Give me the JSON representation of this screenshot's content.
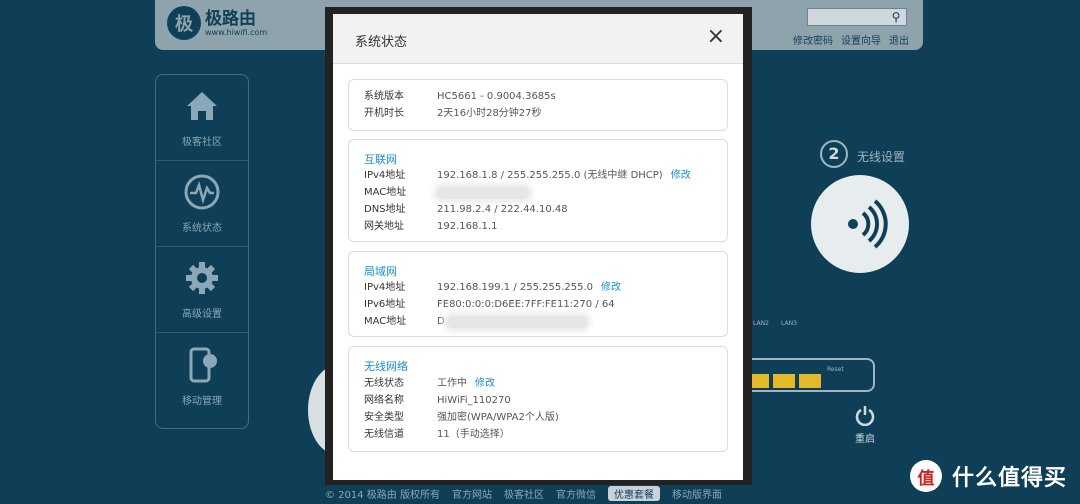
{
  "bg": {
    "logo_mark": "极",
    "logo_name": "极路由",
    "logo_url": "www.hiwifi.com",
    "top_links": [
      "修改密码",
      "设置向导",
      "退出"
    ],
    "sidebar": [
      "极客社区",
      "系统状态",
      "高级设置",
      "移动管理"
    ],
    "step_number": "2",
    "step_label": "无线设置",
    "port_labels": [
      "LAN2",
      "LAN3",
      "Reset"
    ],
    "restart_label": "重启",
    "footer": [
      "© 2014 极路由 版权所有",
      "官方网站",
      "极客社区",
      "官方微信",
      "优惠套餐",
      "移动版界面"
    ]
  },
  "modal": {
    "title": "系统状态",
    "close_icon": "×",
    "system": {
      "rows": [
        {
          "label": "系统版本",
          "value": "HC5661 - 0.9004.3685s"
        },
        {
          "label": "开机时长",
          "value": "2天16小时28分钟27秒"
        }
      ]
    },
    "internet": {
      "title": "互联网",
      "ipv4_label": "IPv4地址",
      "ipv4_value": "192.168.1.8 / 255.255.255.0 (无线中继 DHCP)",
      "ipv4_link": "修改",
      "mac_label": "MAC地址",
      "dns_label": "DNS地址",
      "dns_value": "211.98.2.4 / 222.44.10.48",
      "gw_label": "网关地址",
      "gw_value": "192.168.1.1"
    },
    "lan": {
      "title": "局域网",
      "ipv4_label": "IPv4地址",
      "ipv4_value": "192.168.199.1 / 255.255.255.0",
      "ipv4_link": "修改",
      "ipv6_label": "IPv6地址",
      "ipv6_value": "FE80:0:0:0:D6EE:7FF:FE11:270 / 64",
      "mac_label": "MAC地址",
      "mac_value": "D"
    },
    "wireless": {
      "title": "无线网络",
      "status_label": "无线状态",
      "status_value": "工作中",
      "status_link": "修改",
      "ssid_label": "网络名称",
      "ssid_value": "HiWiFi_110270",
      "sec_label": "安全类型",
      "sec_value": "强加密(WPA/WPA2个人版)",
      "chan_label": "无线信道",
      "chan_value": "11（手动选择）"
    }
  },
  "watermark": {
    "badge": "值",
    "text": "什么值得买"
  }
}
